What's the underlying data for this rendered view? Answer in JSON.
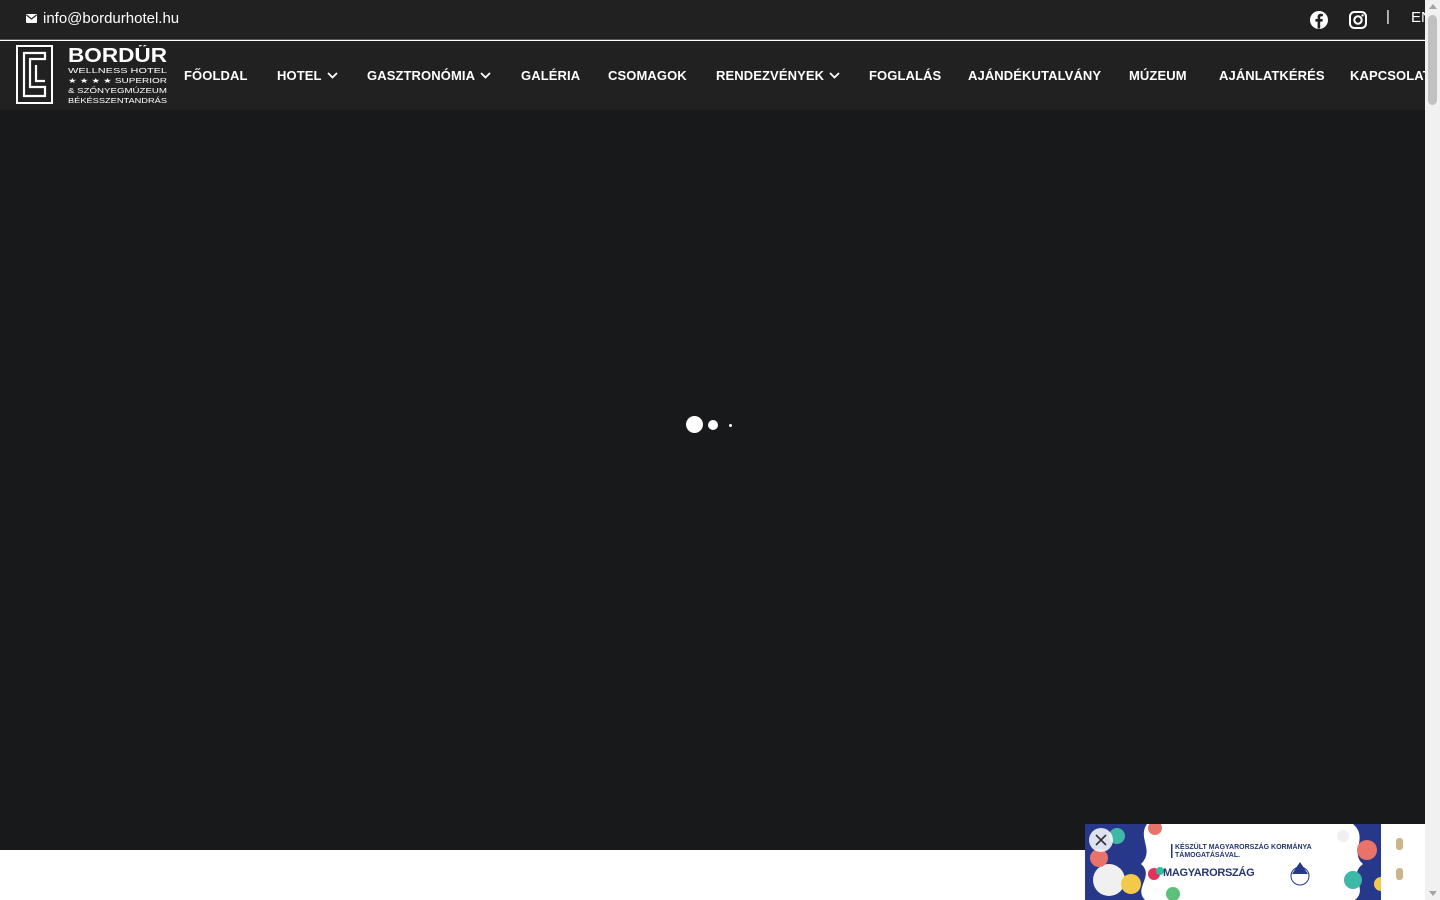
{
  "topbar": {
    "email": "info@bordurhotel.hu",
    "separator": "|",
    "language": "EN"
  },
  "logo": {
    "name": "BORDŰR",
    "line1": "WELLNESS HOTEL",
    "line2": "★ ★ ★ ★ SUPERIOR",
    "line3": "& SZŐNYEGMÚZEUM",
    "line4": "BÉKÉSSZENTANDRÁS"
  },
  "nav": {
    "items": [
      {
        "label": "FŐOLDAL",
        "dropdown": false
      },
      {
        "label": "HOTEL",
        "dropdown": true
      },
      {
        "label": "GASZTRONÓMIA",
        "dropdown": true
      },
      {
        "label": "GALÉRIA",
        "dropdown": false
      },
      {
        "label": "CSOMAGOK",
        "dropdown": false
      },
      {
        "label": "RENDEZVÉNYEK",
        "dropdown": true
      },
      {
        "label": "FOGLALÁS",
        "dropdown": false
      },
      {
        "label": "AJÁNDÉKUTALVÁNY",
        "dropdown": false
      },
      {
        "label": "MÚZEUM",
        "dropdown": false
      },
      {
        "label": "AJÁNLATKÉRÉS",
        "dropdown": false
      },
      {
        "label": "KAPCSOLAT",
        "dropdown": false
      }
    ]
  },
  "banner": {
    "text_line1": "KÉSZÜLT MAGYARORSZÁG KORMÁNYA",
    "text_line2": "TÁMOGATÁSÁVAL.",
    "brand": "MAGYARORSZÁG"
  },
  "colors": {
    "header_bg": "#212122",
    "hero_bg": "#18191b",
    "text": "#ffffff",
    "banner_navy": "#24376e"
  },
  "icons": [
    "envelope-icon",
    "facebook-icon",
    "instagram-icon",
    "chevron-down-icon",
    "close-icon",
    "loading-spinner"
  ]
}
